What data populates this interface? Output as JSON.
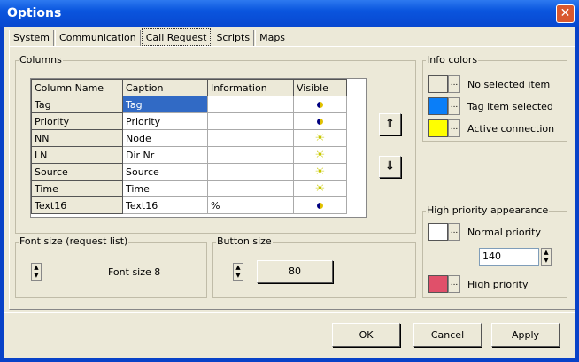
{
  "window": {
    "title": "Options",
    "close_icon": "close-icon"
  },
  "tabs": [
    {
      "label": "System"
    },
    {
      "label": "Communication"
    },
    {
      "label": "Call Request"
    },
    {
      "label": "Scripts"
    },
    {
      "label": "Maps"
    }
  ],
  "columns_group": {
    "label": "Columns",
    "headers": [
      "Column Name",
      "Caption",
      "Information",
      "Visible"
    ],
    "rows": [
      {
        "name": "Tag",
        "caption": "Tag",
        "information": "",
        "visible": "half"
      },
      {
        "name": "Priority",
        "caption": "Priority",
        "information": "",
        "visible": "half"
      },
      {
        "name": "NN",
        "caption": "Node",
        "information": "",
        "visible": "sun"
      },
      {
        "name": "LN",
        "caption": "Dir Nr",
        "information": "",
        "visible": "sun"
      },
      {
        "name": "Source",
        "caption": "Source",
        "information": "",
        "visible": "sun"
      },
      {
        "name": "Time",
        "caption": "Time",
        "information": "",
        "visible": "sun"
      },
      {
        "name": "Text16",
        "caption": "Text16",
        "information": "%",
        "visible": "half"
      }
    ],
    "move_up": "⇑",
    "move_down": "⇓"
  },
  "info_colors": {
    "label": "Info colors",
    "items": [
      {
        "label": "No selected item",
        "color": "#ece9d8"
      },
      {
        "label": "Tag item selected",
        "color": "#0a7ef8"
      },
      {
        "label": "Active connection",
        "color": "#ffff00"
      }
    ]
  },
  "high_priority": {
    "label": "High priority appearance",
    "normal_label": "Normal priority",
    "normal_color": "#ffffff",
    "value": "140",
    "high_label": "High priority",
    "high_color": "#e0506a"
  },
  "font_size": {
    "label": "Font size (request list)",
    "value": "Font size 8"
  },
  "button_size": {
    "label": "Button size",
    "value": "80"
  },
  "buttons": {
    "ok": "OK",
    "cancel": "Cancel",
    "apply": "Apply"
  },
  "ellipsis": "..."
}
